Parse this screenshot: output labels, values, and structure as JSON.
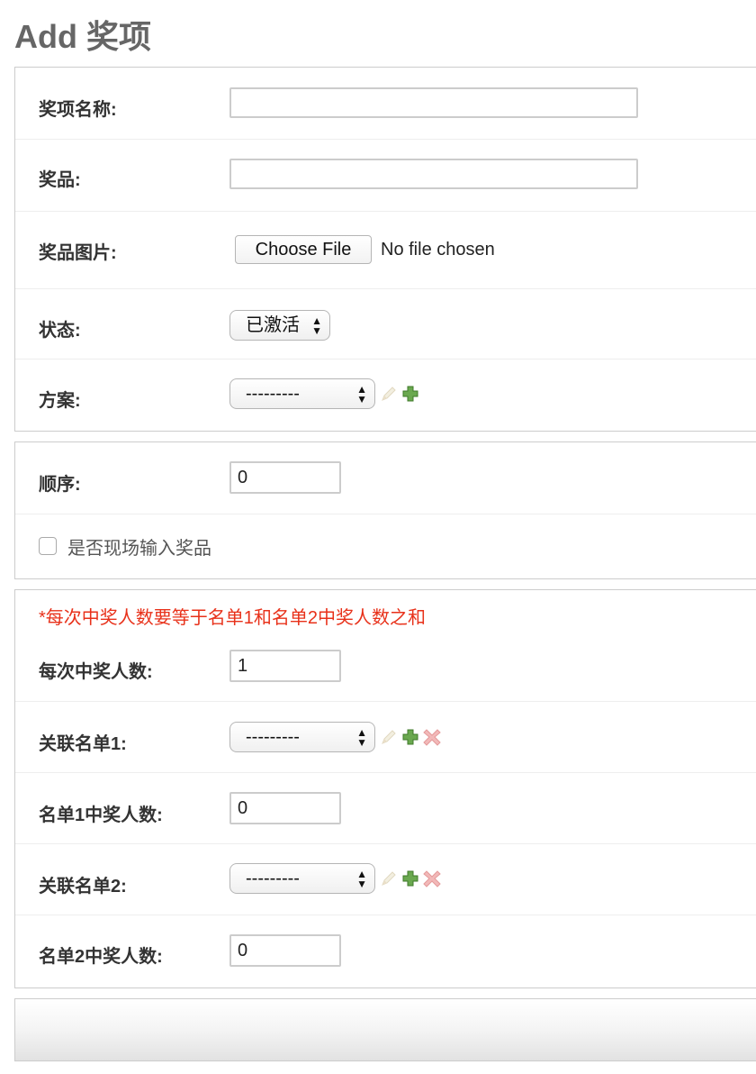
{
  "page": {
    "title": "Add 奖项"
  },
  "fieldset1": {
    "award_name": {
      "label": "奖项名称:",
      "value": ""
    },
    "prize": {
      "label": "奖品:",
      "value": ""
    },
    "prize_image": {
      "label": "奖品图片:",
      "button_label": "Choose File",
      "status": "No file chosen"
    },
    "status": {
      "label": "状态:",
      "selected": "已激活"
    },
    "plan": {
      "label": "方案:",
      "selected": "---------"
    }
  },
  "fieldset2": {
    "order": {
      "label": "顺序:",
      "value": "0"
    },
    "onsite_input": {
      "label": "是否现场输入奖品",
      "checked": false
    }
  },
  "fieldset3": {
    "notice": "*每次中奖人数要等于名单1和名单2中奖人数之和",
    "winners_per_draw": {
      "label": "每次中奖人数:",
      "value": "1"
    },
    "list1": {
      "label": "关联名单1:",
      "selected": "---------"
    },
    "list1_winners": {
      "label": "名单1中奖人数:",
      "value": "0"
    },
    "list2": {
      "label": "关联名单2:",
      "selected": "---------"
    },
    "list2_winners": {
      "label": "名单2中奖人数:",
      "value": "0"
    }
  },
  "icons": {
    "edit": "pencil-icon",
    "add": "plus-icon",
    "delete": "delete-x-icon"
  },
  "colors": {
    "notice_red": "#e8311a",
    "add_green": "#5b9a3a",
    "delete_pink": "#f0b8b8",
    "edit_disabled": "#e8e2d0"
  }
}
